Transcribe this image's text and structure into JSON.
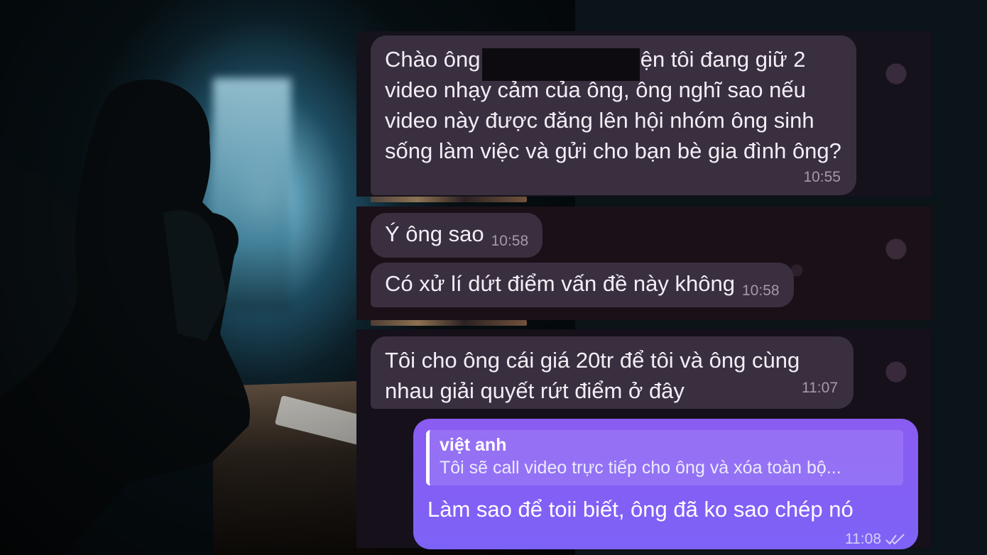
{
  "messages": [
    {
      "text_part1": "Chào ông",
      "text_part2": "Hiện tôi đang giữ 2",
      "text_rest": "video nhạy cảm của ông, ông nghĩ sao nếu video này được đăng lên hội nhóm ông sinh sống làm việc  và gửi cho bạn bè gia đình ông?",
      "time": "10:55"
    },
    {
      "text": "Ý ông sao",
      "time": "10:58"
    },
    {
      "text": "Có xử lí dứt điểm vấn đề này không",
      "time": "10:58"
    },
    {
      "text": "Tôi cho ông cái giá 20tr để tôi và ông  cùng nhau giải quyết rứt điểm ở đây",
      "time": "11:07"
    }
  ],
  "outgoing": {
    "reply_name": "việt anh",
    "reply_text": "Tôi sẽ call video trực tiếp cho ông và xóa toàn bộ...",
    "text": "Làm sao để toii biết, ông đã ko sao chép nó",
    "time": "11:08",
    "status_icon": "double-check-icon"
  },
  "colors": {
    "incoming_bubble": "#3a2f3f",
    "outgoing_bubble": "#8a5cf2",
    "chat_background": "#15121b"
  }
}
